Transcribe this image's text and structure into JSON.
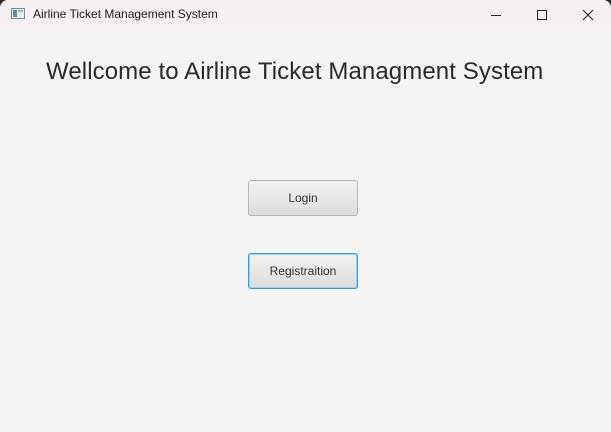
{
  "window": {
    "title": "Airline Ticket Management System",
    "icons": {
      "app": "app-window-icon",
      "minimize": "minimize-icon",
      "maximize": "maximize-icon",
      "close": "close-icon"
    }
  },
  "main": {
    "heading": "Wellcome to Airline Ticket Managment System",
    "login_label": "Login",
    "registration_label": "Registraition"
  },
  "colors": {
    "background": "#f4f4f4",
    "titlebar": "#f6f0f1",
    "focus_border": "#3a9ad9"
  }
}
